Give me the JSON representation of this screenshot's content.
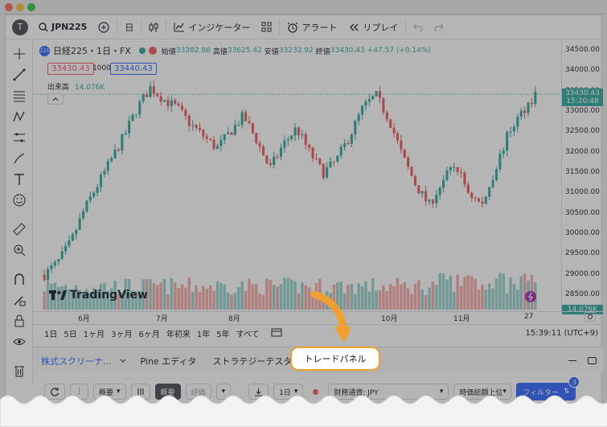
{
  "window": {
    "traffic_colors": [
      "#ff5f57",
      "#febc2e",
      "#28c840"
    ]
  },
  "topbar": {
    "avatar_letter": "T",
    "symbol": "JPN225",
    "interval": "日",
    "indicators": "インジケーター",
    "alert": "アラート",
    "replay": "リプレイ"
  },
  "legend": {
    "name": "日経225・1日・FX",
    "badge": "225",
    "open_label": "始値",
    "open": "33382.86",
    "high_label": "高値",
    "high": "33625.42",
    "low_label": "安値",
    "low": "33232.92",
    "close_label": "終値",
    "close": "33430.43",
    "change": "+47.57 (+0.14%)",
    "bid": "33430.43",
    "spread": "1000",
    "ask": "33440.43",
    "volume_label": "出来高",
    "volume": "14.076K"
  },
  "price_axis": {
    "labels": [
      "34500.00",
      "34000.00",
      "33500.00",
      "33000.00",
      "32500.00",
      "32000.00",
      "31500.00",
      "31000.00",
      "30500.00",
      "30000.00",
      "29500.00",
      "29000.00",
      "28500.00"
    ],
    "last_price": "33430.43",
    "countdown": "15:20:48",
    "volume_tag": "14.076K"
  },
  "date_axis": {
    "labels": [
      "6月",
      "7月",
      "8月",
      "10月",
      "11月",
      "27"
    ]
  },
  "watermark": "TradingView",
  "periods": [
    "1日",
    "5日",
    "1ヶ月",
    "3ヶ月",
    "6ヶ月",
    "年初来",
    "1年",
    "5年",
    "すべて"
  ],
  "clock": "15:39:11 (UTC+9)",
  "tabs": {
    "screener": "株式スクリーナ...",
    "pine": "Pine エディタ",
    "tester": "ストラテジーテスター",
    "trade": "トレードパネル"
  },
  "bottom": {
    "overview": "概要",
    "overview2": "概要",
    "rating": "評価",
    "interval": "1日",
    "currency": "財務通貨: JPY",
    "sort": "時価総額上位",
    "filter": "フィルター",
    "filter_count": "3"
  },
  "chart_data": {
    "type": "candlestick",
    "x": [
      "6月",
      "7月",
      "8月",
      "10月",
      "11月"
    ],
    "ylim": [
      28500,
      34500
    ],
    "last": 33430.43,
    "series": [
      {
        "values": [
          29000,
          29300,
          29800,
          30600,
          31200,
          31800,
          32400,
          33100,
          33600,
          33300,
          33100,
          32700,
          32400,
          32100,
          32500,
          32900,
          32300,
          31600,
          32200,
          32600,
          32000,
          31500,
          31800,
          32400,
          33100,
          33400,
          32800,
          31900,
          31200,
          30700,
          31300,
          31700,
          31000,
          30700,
          31600,
          32500,
          33000,
          33430
        ]
      }
    ]
  }
}
